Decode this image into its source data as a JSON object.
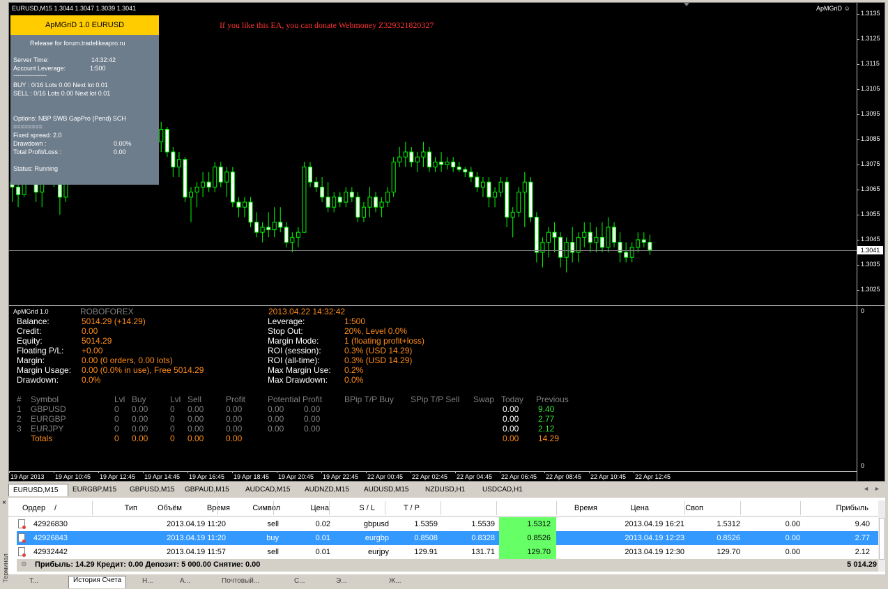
{
  "chart": {
    "title": "EURUSD,M15  1.3044 1.3047 1.3039 1.3041",
    "indicator_name": "ApMGriD",
    "donate_text": "If you like this EA, you can donate Webmoney Z329321820327",
    "current_price": "1.3041",
    "price_ticks": [
      "1.3135",
      "1.3125",
      "1.3115",
      "1.3105",
      "1.3095",
      "1.3085",
      "1.3075",
      "1.3065",
      "1.3055",
      "1.3045",
      "1.3035",
      "1.3025"
    ],
    "subwindow_ticks": [
      "0",
      "0"
    ],
    "time_labels": [
      "19 Apr 2013",
      "19 Apr 10:45",
      "19 Apr 12:45",
      "19 Apr 14:45",
      "19 Apr 16:45",
      "19 Apr 18:45",
      "19 Apr 20:45",
      "19 Apr 22:45",
      "22 Apr 00:45",
      "22 Apr 02:45",
      "22 Apr 04:45",
      "22 Apr 06:45",
      "22 Apr 08:45",
      "22 Apr 10:45",
      "22 Apr 12:45"
    ]
  },
  "ea_panel": {
    "header": "ApMGriD 1.0 EURUSD",
    "release": "Release for forum.tradelikeapro.ru",
    "server_time_label": "Server Time:",
    "server_time": "14:32:42",
    "leverage_label": "Account Leverage:",
    "leverage": "1:500",
    "separator": "----------------",
    "buy_line": "BUY : 0/16  Lots 0.00 Next lot 0.01",
    "sell_line": "SELL : 0/16  Lots 0.00 Next lot 0.01",
    "options": "Options: NBP SWB GapPro (Pend) SCH",
    "equals": "========",
    "fixed_spread": "Fixed spread: 2.0",
    "drawdown_label": "Drawdown :",
    "drawdown": "0.00%",
    "total_pl_label": "Total Profit/Loss :",
    "total_pl": "0.00",
    "status": "Status: Running"
  },
  "sub": {
    "name": "ApMGrid 1.0",
    "broker": "ROBOFOREX",
    "datetime": "2013.04.22 14:32:42",
    "left": [
      {
        "label": "Balance:",
        "value": "5014.29 (+14.29)"
      },
      {
        "label": "Credit:",
        "value": "0.00"
      },
      {
        "label": "Equity:",
        "value": "5014.29"
      },
      {
        "label": "Floating P/L:",
        "value": "+0.00"
      },
      {
        "label": "Margin:",
        "value": "0.00 (0 orders, 0.00 lots)"
      },
      {
        "label": "Margin Usage:",
        "value": "0.00 (0.0% in use), Free 5014.29"
      },
      {
        "label": "Drawdown:",
        "value": "0.0%"
      }
    ],
    "right": [
      {
        "label": "Leverage:",
        "value": "1:500"
      },
      {
        "label": "Stop Out:",
        "value": "20%, Level 0.0%"
      },
      {
        "label": "Margin Mode:",
        "value": "1 (floating profit+loss)"
      },
      {
        "label": "ROI (session):",
        "value": "0.3% (USD 14.29)"
      },
      {
        "label": "ROI (all-time):",
        "value": "0.3% (USD 14.29)"
      },
      {
        "label": "Max Margin Use:",
        "value": "0.2%"
      },
      {
        "label": "Max Drawdown:",
        "value": "0.0%"
      }
    ],
    "table_headers": [
      "#",
      "Symbol",
      "Lvl",
      "Buy",
      "Lvl",
      "Sell",
      "Profit",
      "Potential Profit",
      "BPip T/P Buy",
      "SPip T/P Sell",
      "Swap",
      "Today",
      "Previous"
    ],
    "rows": [
      {
        "n": "1",
        "symbol": "GBPUSD",
        "lvl1": "0",
        "buy": "0.00",
        "lvl2": "0",
        "sell": "0.00",
        "profit": "0.00",
        "pp1": "0.00",
        "pp2": "0.00",
        "today": "0.00",
        "previous": "9.40"
      },
      {
        "n": "2",
        "symbol": "EURGBP",
        "lvl1": "0",
        "buy": "0.00",
        "lvl2": "0",
        "sell": "0.00",
        "profit": "0.00",
        "pp1": "0.00",
        "pp2": "0.00",
        "today": "0.00",
        "previous": "2.77"
      },
      {
        "n": "3",
        "symbol": "EURJPY",
        "lvl1": "0",
        "buy": "0.00",
        "lvl2": "0",
        "sell": "0.00",
        "profit": "0.00",
        "pp1": "0.00",
        "pp2": "0.00",
        "today": "0.00",
        "previous": "2.12"
      }
    ],
    "totals": {
      "label": "Totals",
      "lvl1": "0",
      "buy": "0.00",
      "lvl2": "0",
      "sell": "0.00",
      "profit": "0.00",
      "today": "0.00",
      "previous": "14.29"
    }
  },
  "tabs": [
    "EURUSD,M15",
    "EURGBP,M15",
    "GBPUSD,M15",
    "GBPAUD,M15",
    "AUDCAD,M15",
    "AUDNZD,M15",
    "AUDUSD,M15",
    "NZDUSD,H1",
    "USDCAD,H1"
  ],
  "terminal": {
    "headers": [
      "Ордер",
      "/",
      "Время",
      "Тип",
      "Объём",
      "Символ",
      "Цена",
      "S / L",
      "T / P",
      "Время",
      "Цена",
      "Своп",
      "Прибыль"
    ],
    "rows": [
      {
        "order": "42926830",
        "time": "2013.04.19 11:20",
        "type": "sell",
        "volume": "0.02",
        "symbol": "gbpusd",
        "price": "1.5359",
        "sl": "1.5539",
        "tp": "1.5312",
        "close_time": "2013.04.19 16:21",
        "close_price": "1.5312",
        "swap": "0.00",
        "profit": "9.40"
      },
      {
        "order": "42926843",
        "time": "2013.04.19 11:20",
        "type": "buy",
        "volume": "0.01",
        "symbol": "eurgbp",
        "price": "0.8508",
        "sl": "0.8328",
        "tp": "0.8526",
        "close_time": "2013.04.19 12:23",
        "close_price": "0.8526",
        "swap": "0.00",
        "profit": "2.77"
      },
      {
        "order": "42932442",
        "time": "2013.04.19 11:57",
        "type": "sell",
        "volume": "0.01",
        "symbol": "eurjpy",
        "price": "129.91",
        "sl": "131.71",
        "tp": "129.70",
        "close_time": "2013.04.19 12:30",
        "close_price": "129.70",
        "swap": "0.00",
        "profit": "2.12"
      }
    ],
    "summary": "Прибыль: 14.29   Кредит: 0.00   Депозит: 5 000.00   Снятие: 0.00",
    "summary_total": "5 014.29",
    "side_label": "Терминал",
    "bottom_tabs": [
      "Т...",
      "История Счета",
      "Н...",
      "А...",
      "Почтовый...",
      "С...",
      "Э...",
      "Ж..."
    ]
  },
  "colors": {
    "candle": "#00ff00",
    "accent_orange": "#ff8c1a",
    "selected_row": "#3399ff",
    "tp_cell": "#66ff66"
  },
  "candles": [
    [
      1.3068,
      1.3075,
      1.306,
      1.3066
    ],
    [
      1.3066,
      1.3072,
      1.3058,
      1.3063
    ],
    [
      1.3063,
      1.308,
      1.3062,
      1.3076
    ],
    [
      1.3076,
      1.3082,
      1.3068,
      1.307
    ],
    [
      1.307,
      1.3078,
      1.306,
      1.3064
    ],
    [
      1.3064,
      1.3075,
      1.3058,
      1.3072
    ],
    [
      1.3072,
      1.3084,
      1.307,
      1.308
    ],
    [
      1.308,
      1.3086,
      1.3066,
      1.3068
    ],
    [
      1.3068,
      1.3072,
      1.3055,
      1.3062
    ],
    [
      1.3062,
      1.3078,
      1.306,
      1.3075
    ],
    [
      1.3075,
      1.3088,
      1.3072,
      1.3082
    ],
    [
      1.3082,
      1.3092,
      1.3078,
      1.3088
    ],
    [
      1.3088,
      1.3092,
      1.3078,
      1.308
    ],
    [
      1.308,
      1.3086,
      1.3072,
      1.3076
    ],
    [
      1.3076,
      1.308,
      1.307,
      1.3074
    ],
    [
      1.3074,
      1.308,
      1.3075,
      1.3077
    ],
    [
      1.3077,
      1.309,
      1.3076,
      1.3086
    ],
    [
      1.3086,
      1.3096,
      1.3082,
      1.309
    ],
    [
      1.309,
      1.3096,
      1.3072,
      1.3074
    ],
    [
      1.3074,
      1.3084,
      1.307,
      1.3078
    ],
    [
      1.3078,
      1.3132,
      1.3076,
      1.3118
    ],
    [
      1.3118,
      1.3126,
      1.3106,
      1.311
    ],
    [
      1.311,
      1.3112,
      1.3095,
      1.3098
    ],
    [
      1.3098,
      1.3108,
      1.309,
      1.3095
    ],
    [
      1.3095,
      1.3098,
      1.308,
      1.3084
    ],
    [
      1.3084,
      1.3092,
      1.308,
      1.3089
    ],
    [
      1.3089,
      1.309,
      1.3078,
      1.308
    ],
    [
      1.308,
      1.3082,
      1.307,
      1.3074
    ],
    [
      1.3074,
      1.308,
      1.307,
      1.3077
    ],
    [
      1.3077,
      1.3078,
      1.306,
      1.3062
    ],
    [
      1.3062,
      1.3066,
      1.3052,
      1.3064
    ],
    [
      1.3064,
      1.3068,
      1.3058,
      1.3066
    ],
    [
      1.3066,
      1.3072,
      1.3062,
      1.3068
    ],
    [
      1.3068,
      1.3072,
      1.3064,
      1.3066
    ],
    [
      1.3066,
      1.3076,
      1.3064,
      1.3074
    ],
    [
      1.3074,
      1.3076,
      1.3066,
      1.3068
    ],
    [
      1.3068,
      1.3074,
      1.3062,
      1.3072
    ],
    [
      1.3072,
      1.3074,
      1.3058,
      1.306
    ],
    [
      1.306,
      1.3062,
      1.3054,
      1.3058
    ],
    [
      1.3058,
      1.3062,
      1.3054,
      1.306
    ],
    [
      1.306,
      1.3062,
      1.305,
      1.3052
    ],
    [
      1.3052,
      1.3056,
      1.3046,
      1.3048
    ],
    [
      1.3048,
      1.3052,
      1.3044,
      1.305
    ],
    [
      1.305,
      1.3056,
      1.3046,
      1.3049
    ],
    [
      1.3049,
      1.3058,
      1.3046,
      1.3052
    ],
    [
      1.3052,
      1.3058,
      1.3048,
      1.305
    ],
    [
      1.305,
      1.3052,
      1.3042,
      1.3044
    ],
    [
      1.3044,
      1.3048,
      1.304,
      1.3046
    ],
    [
      1.3046,
      1.305,
      1.3042,
      1.3048
    ],
    [
      1.3048,
      1.3076,
      1.3048,
      1.3074
    ],
    [
      1.3074,
      1.3076,
      1.3066,
      1.3068
    ],
    [
      1.3068,
      1.307,
      1.3064,
      1.3066
    ],
    [
      1.3066,
      1.307,
      1.306,
      1.3062
    ],
    [
      1.3062,
      1.3068,
      1.3056,
      1.3058
    ],
    [
      1.3058,
      1.3064,
      1.3056,
      1.3062
    ],
    [
      1.3062,
      1.3064,
      1.3058,
      1.306
    ],
    [
      1.306,
      1.3066,
      1.3058,
      1.3064
    ],
    [
      1.3064,
      1.3066,
      1.306,
      1.3062
    ],
    [
      1.3062,
      1.3064,
      1.3052,
      1.3054
    ],
    [
      1.3054,
      1.306,
      1.3052,
      1.3058
    ],
    [
      1.3058,
      1.3066,
      1.3054,
      1.3062
    ],
    [
      1.3062,
      1.3064,
      1.3056,
      1.3058
    ],
    [
      1.3058,
      1.3062,
      1.3054,
      1.306
    ],
    [
      1.306,
      1.3066,
      1.3058,
      1.3064
    ],
    [
      1.3064,
      1.3078,
      1.3062,
      1.3076
    ],
    [
      1.3076,
      1.3082,
      1.3074,
      1.3078
    ],
    [
      1.3078,
      1.3084,
      1.3074,
      1.308
    ],
    [
      1.308,
      1.3082,
      1.3074,
      1.3076
    ],
    [
      1.3076,
      1.308,
      1.3072,
      1.3078
    ],
    [
      1.3078,
      1.3084,
      1.3074,
      1.308
    ],
    [
      1.308,
      1.3082,
      1.3072,
      1.3074
    ],
    [
      1.3074,
      1.3078,
      1.3072,
      1.3076
    ],
    [
      1.3076,
      1.308,
      1.3072,
      1.3075
    ],
    [
      1.3075,
      1.3078,
      1.3073,
      1.3076
    ],
    [
      1.3076,
      1.3078,
      1.3072,
      1.3074
    ],
    [
      1.3074,
      1.3076,
      1.3072,
      1.3073
    ],
    [
      1.3073,
      1.3074,
      1.307,
      1.3072
    ],
    [
      1.3072,
      1.3074,
      1.3068,
      1.307
    ],
    [
      1.307,
      1.3072,
      1.3064,
      1.3066
    ],
    [
      1.3066,
      1.307,
      1.3062,
      1.3068
    ],
    [
      1.3068,
      1.307,
      1.3058,
      1.3062
    ],
    [
      1.3062,
      1.3066,
      1.3058,
      1.3064
    ],
    [
      1.3064,
      1.307,
      1.3062,
      1.3068
    ],
    [
      1.3068,
      1.307,
      1.305,
      1.3054
    ],
    [
      1.3054,
      1.3058,
      1.3046,
      1.3056
    ],
    [
      1.3056,
      1.3066,
      1.3054,
      1.3064
    ],
    [
      1.3064,
      1.3072,
      1.305,
      1.3068
    ],
    [
      1.3068,
      1.307,
      1.3052,
      1.3054
    ],
    [
      1.3054,
      1.3056,
      1.3036,
      1.304
    ],
    [
      1.304,
      1.3046,
      1.3034,
      1.3044
    ],
    [
      1.3044,
      1.305,
      1.3038,
      1.3048
    ],
    [
      1.3048,
      1.3052,
      1.304,
      1.3046
    ],
    [
      1.3046,
      1.3048,
      1.3034,
      1.3038
    ],
    [
      1.3038,
      1.3046,
      1.3032,
      1.3044
    ],
    [
      1.3044,
      1.305,
      1.3036,
      1.304
    ],
    [
      1.304,
      1.3048,
      1.3036,
      1.3046
    ],
    [
      1.3046,
      1.3052,
      1.3042,
      1.3048
    ],
    [
      1.3048,
      1.3052,
      1.304,
      1.3044
    ],
    [
      1.3044,
      1.305,
      1.304,
      1.3046
    ],
    [
      1.3046,
      1.3052,
      1.304,
      1.3042
    ],
    [
      1.3042,
      1.3054,
      1.304,
      1.305
    ],
    [
      1.305,
      1.3052,
      1.3042,
      1.3044
    ],
    [
      1.3044,
      1.3048,
      1.3036,
      1.304
    ],
    [
      1.304,
      1.3044,
      1.3036,
      1.3038
    ],
    [
      1.3038,
      1.3044,
      1.3036,
      1.3042
    ],
    [
      1.3042,
      1.3048,
      1.304,
      1.3045
    ],
    [
      1.3045,
      1.3048,
      1.3042,
      1.3044
    ],
    [
      1.3044,
      1.3047,
      1.3039,
      1.3041
    ]
  ]
}
